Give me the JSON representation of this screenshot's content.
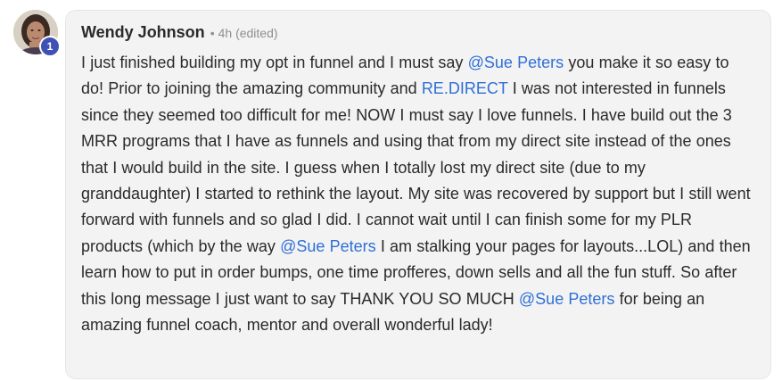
{
  "comment": {
    "author": "Wendy Johnson",
    "separator": "•",
    "time": "4h",
    "edited": "(edited)",
    "level": "1",
    "body": [
      {
        "type": "text",
        "value": "I just finished building my opt in funnel and I must say "
      },
      {
        "type": "mention",
        "value": "@Sue Peters"
      },
      {
        "type": "text",
        "value": " you make it so easy to do! Prior to joining the amazing community and "
      },
      {
        "type": "mention",
        "value": "RE.DIRECT"
      },
      {
        "type": "text",
        "value": " I was not interested in funnels since they seemed too difficult for me! NOW I must say I love funnels. I have build out the 3 MRR programs that I have as funnels and using that from my direct site instead of the ones that I would build in the site. I guess when I totally lost my direct site (due to my granddaughter) I started to rethink the layout. My site was recovered by support but I still went forward with funnels and so glad I did. I cannot wait until I can finish some for my PLR products (which by the way "
      },
      {
        "type": "mention",
        "value": "@Sue Peters"
      },
      {
        "type": "text",
        "value": " I am stalking your pages for layouts...LOL) and then learn how to put in order bumps, one time profferes, down sells and all the fun stuff. So after this long message I just want to say THANK YOU SO MUCH "
      },
      {
        "type": "mention",
        "value": "@Sue Peters"
      },
      {
        "type": "text",
        "value": " for being an amazing funnel coach, mentor and overall wonderful lady!"
      }
    ]
  },
  "colors": {
    "mention": "#2f6fd6",
    "badge": "#3f51b5",
    "bubble": "#f3f3f3"
  }
}
